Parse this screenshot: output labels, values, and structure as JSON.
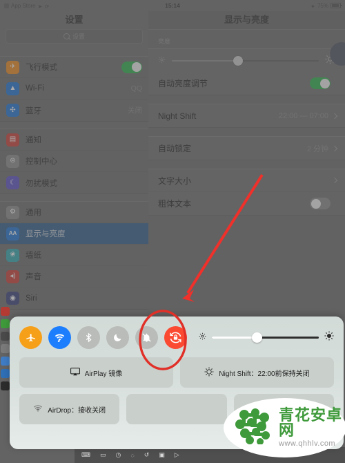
{
  "statusbar": {
    "app_label": "App Store",
    "time": "15:14",
    "battery_percent": "75%"
  },
  "sidebar": {
    "title": "设置",
    "search_placeholder": "设置",
    "search_value": "",
    "groups": [
      {
        "items": [
          {
            "label": "飞行模式",
            "icon": "airplane-icon",
            "color": "#f08a1d",
            "control": "switch",
            "state": "on"
          },
          {
            "label": "Wi-Fi",
            "icon": "wifi-icon",
            "color": "#1d74d8",
            "control": "value",
            "value": "QQ"
          },
          {
            "label": "蓝牙",
            "icon": "bluetooth-icon",
            "color": "#1d74d8",
            "control": "value",
            "value": "关闭"
          }
        ]
      },
      {
        "items": [
          {
            "label": "通知",
            "icon": "notification-icon",
            "color": "#cf3b32",
            "control": "none",
            "value": ""
          },
          {
            "label": "控制中心",
            "icon": "control-center-icon",
            "color": "#8c8c8c",
            "control": "none",
            "value": ""
          },
          {
            "label": "勿扰模式",
            "icon": "moon-icon",
            "color": "#5b4fc9",
            "control": "none",
            "value": ""
          }
        ]
      },
      {
        "items": [
          {
            "label": "通用",
            "icon": "gear-icon",
            "color": "#8c8c8c",
            "control": "none",
            "value": ""
          },
          {
            "label": "显示与亮度",
            "icon": "text-size-aa-icon",
            "color": "#1d74d8",
            "control": "none",
            "value": "",
            "selected": true
          },
          {
            "label": "墙纸",
            "icon": "wallpaper-icon",
            "color": "#2fa9b5",
            "control": "none",
            "value": ""
          },
          {
            "label": "声音",
            "icon": "speaker-icon",
            "color": "#cf3b32",
            "control": "none",
            "value": ""
          },
          {
            "label": "Siri",
            "icon": "siri-icon",
            "color": "#3a3f7a",
            "control": "none",
            "value": ""
          }
        ]
      }
    ]
  },
  "detail": {
    "title": "显示与亮度",
    "brightness_section_header": "亮度",
    "brightness_percent": 45,
    "auto_brightness": {
      "label": "自动亮度调节",
      "state": "on"
    },
    "rows": [
      {
        "label": "Night Shift",
        "value": "22:00 — 07:00",
        "chevron": true
      },
      {
        "label": "自动锁定",
        "value": "2 分钟",
        "chevron": true
      },
      {
        "label": "文字大小",
        "value": "",
        "chevron": true
      },
      {
        "label": "粗体文本",
        "value": "",
        "chevron": false,
        "control": "switch",
        "state": "off"
      }
    ]
  },
  "control_center": {
    "buttons": [
      {
        "name": "airplane-mode-button",
        "icon": "airplane-icon",
        "state": "on",
        "style": "orange"
      },
      {
        "name": "wifi-button",
        "icon": "wifi-icon",
        "state": "on",
        "style": "blue"
      },
      {
        "name": "bluetooth-button",
        "icon": "bluetooth-icon",
        "state": "off",
        "style": "off"
      },
      {
        "name": "do-not-disturb-button",
        "icon": "moon-icon",
        "state": "off",
        "style": "off"
      },
      {
        "name": "mute-button",
        "icon": "bell-slash-icon",
        "state": "off",
        "style": "off"
      },
      {
        "name": "rotation-lock-button",
        "icon": "rotation-lock-icon",
        "state": "on",
        "style": "red",
        "highlighted": true
      }
    ],
    "brightness_percent": 42,
    "tiles": [
      {
        "name": "airplay-tile",
        "label": "AirPlay 镜像",
        "icon": "airplay-icon"
      },
      {
        "name": "night-shift-tile",
        "label": "Night Shift：22:00前保持关闭",
        "icon": "night-shift-icon"
      }
    ],
    "tiles_row2": [
      {
        "name": "airdrop-tile",
        "label": "AirDrop：接收关闭",
        "icon": "airdrop-icon"
      },
      {
        "name": "quick-tile-1",
        "label": "",
        "icon": ""
      },
      {
        "name": "quick-tile-2",
        "label": "",
        "icon": ""
      }
    ]
  },
  "annotation": {
    "arrow_color": "#f0302a",
    "ellipse_color": "#e03028",
    "target": "rotation-lock-button"
  },
  "watermark": {
    "title": "青花安卓网",
    "url": "www.qhhlv.com"
  }
}
